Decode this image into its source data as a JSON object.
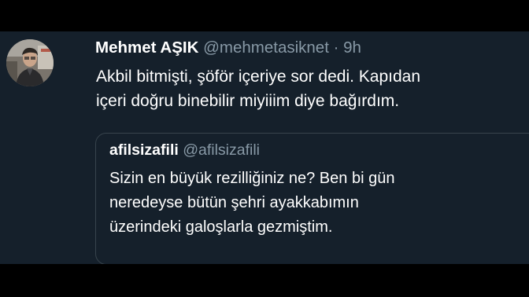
{
  "tweet": {
    "author_name": "Mehmet AŞIK",
    "author_handle": "@mehmetasiknet",
    "separator": "·",
    "timestamp": "9h",
    "text_lines": [
      "Akbil bitmişti, şöför içeriye sor dedi. Kapıdan",
      "içeri doğru binebilir miyiiim diye bağırdım."
    ],
    "avatar_icon": "profile-photo"
  },
  "quoted_tweet": {
    "author_name": "afilsizafili",
    "author_handle": "@afilsizafili",
    "text_lines": [
      "Sizin en büyük rezilliğiniz ne? Ben bi gün",
      "neredeyse bütün şehri ayakkabımın",
      "üzerindeki galoşlarla gezmiştim."
    ]
  },
  "colors": {
    "background": "#15202b",
    "frame": "#000000",
    "primary_text": "#ffffff",
    "secondary_text": "#8899a6",
    "border": "#38444d"
  }
}
